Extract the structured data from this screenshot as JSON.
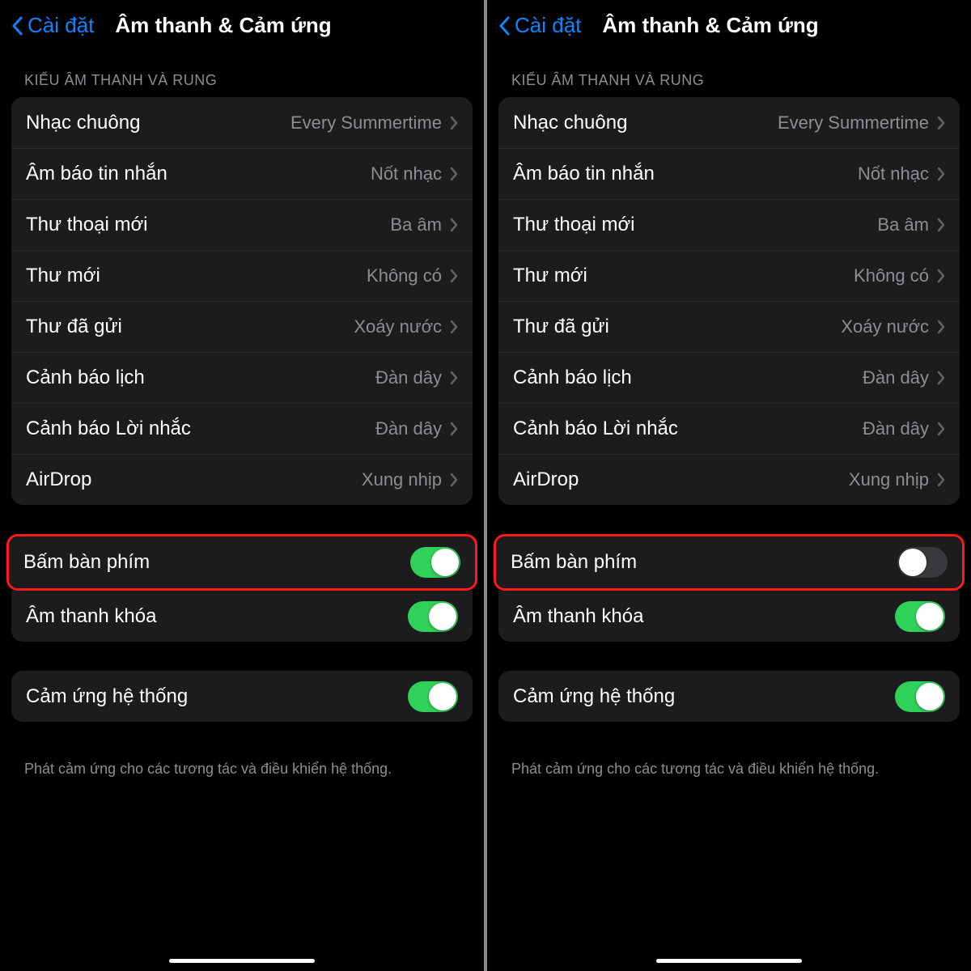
{
  "screens": [
    {
      "back": "Cài đặt",
      "title": "Âm thanh & Cảm ứng",
      "section_header": "KIỂU ÂM THANH VÀ RUNG",
      "items": [
        {
          "label": "Nhạc chuông",
          "value": "Every Summertime"
        },
        {
          "label": "Âm báo tin nhắn",
          "value": "Nốt nhạc"
        },
        {
          "label": "Thư thoại mới",
          "value": "Ba âm"
        },
        {
          "label": "Thư mới",
          "value": "Không có"
        },
        {
          "label": "Thư đã gửi",
          "value": "Xoáy nước"
        },
        {
          "label": "Cảnh báo lịch",
          "value": "Đàn dây"
        },
        {
          "label": "Cảnh báo Lời nhắc",
          "value": "Đàn dây"
        },
        {
          "label": "AirDrop",
          "value": "Xung nhịp"
        }
      ],
      "toggles": {
        "keyboard": {
          "label": "Bấm bàn phím",
          "on": true
        },
        "lock": {
          "label": "Âm thanh khóa",
          "on": true
        },
        "system": {
          "label": "Cảm ứng hệ thống",
          "on": true
        }
      },
      "footer": "Phát cảm ứng cho các tương tác và điều khiển hệ thống."
    },
    {
      "back": "Cài đặt",
      "title": "Âm thanh & Cảm ứng",
      "section_header": "KIỂU ÂM THANH VÀ RUNG",
      "items": [
        {
          "label": "Nhạc chuông",
          "value": "Every Summertime"
        },
        {
          "label": "Âm báo tin nhắn",
          "value": "Nốt nhạc"
        },
        {
          "label": "Thư thoại mới",
          "value": "Ba âm"
        },
        {
          "label": "Thư mới",
          "value": "Không có"
        },
        {
          "label": "Thư đã gửi",
          "value": "Xoáy nước"
        },
        {
          "label": "Cảnh báo lịch",
          "value": "Đàn dây"
        },
        {
          "label": "Cảnh báo Lời nhắc",
          "value": "Đàn dây"
        },
        {
          "label": "AirDrop",
          "value": "Xung nhịp"
        }
      ],
      "toggles": {
        "keyboard": {
          "label": "Bấm bàn phím",
          "on": false
        },
        "lock": {
          "label": "Âm thanh khóa",
          "on": true
        },
        "system": {
          "label": "Cảm ứng hệ thống",
          "on": true
        }
      },
      "footer": "Phát cảm ứng cho các tương tác và điều khiển hệ thống."
    }
  ]
}
